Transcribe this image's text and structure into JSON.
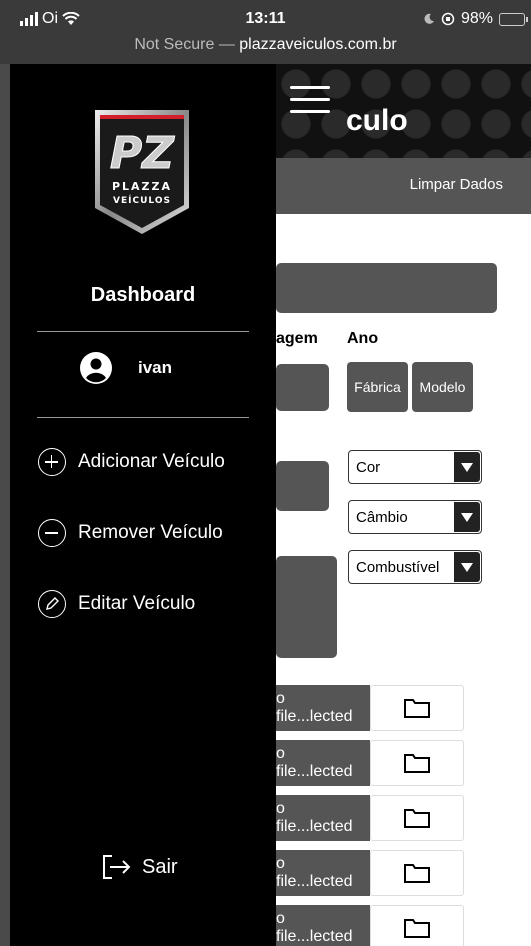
{
  "status_bar": {
    "carrier": "Oi",
    "time": "13:11",
    "battery": "98%",
    "battery_level": 0.98,
    "security": "Not Secure —",
    "domain": "plazzaveiculos.com.br"
  },
  "background_page": {
    "title_fragment": "culo",
    "clear_button": "Limpar Dados",
    "label_fragment": "agem",
    "label_ano": "Ano",
    "btn_fabrica": "Fábrica",
    "btn_modelo": "Modelo",
    "selects": [
      {
        "value": "Cor"
      },
      {
        "value": "Câmbio"
      },
      {
        "value": "Combustível"
      }
    ],
    "file_rows": [
      {
        "text": "o file...lected"
      },
      {
        "text": "o file...lected"
      },
      {
        "text": "o file...lected"
      },
      {
        "text": "o file...lected"
      },
      {
        "text": "o file...lected"
      }
    ]
  },
  "sidebar": {
    "logo_text_line1": "PLAZZA",
    "logo_text_line2": "VEÍCULOS",
    "logo_monogram": "PZ",
    "dashboard": "Dashboard",
    "username": "ivan",
    "menu": [
      {
        "label": "Adicionar Veículo",
        "icon": "plus-circle-icon"
      },
      {
        "label": "Remover Veículo",
        "icon": "minus-circle-icon"
      },
      {
        "label": "Editar Veículo",
        "icon": "pencil-circle-icon"
      }
    ],
    "logout": "Sair"
  }
}
